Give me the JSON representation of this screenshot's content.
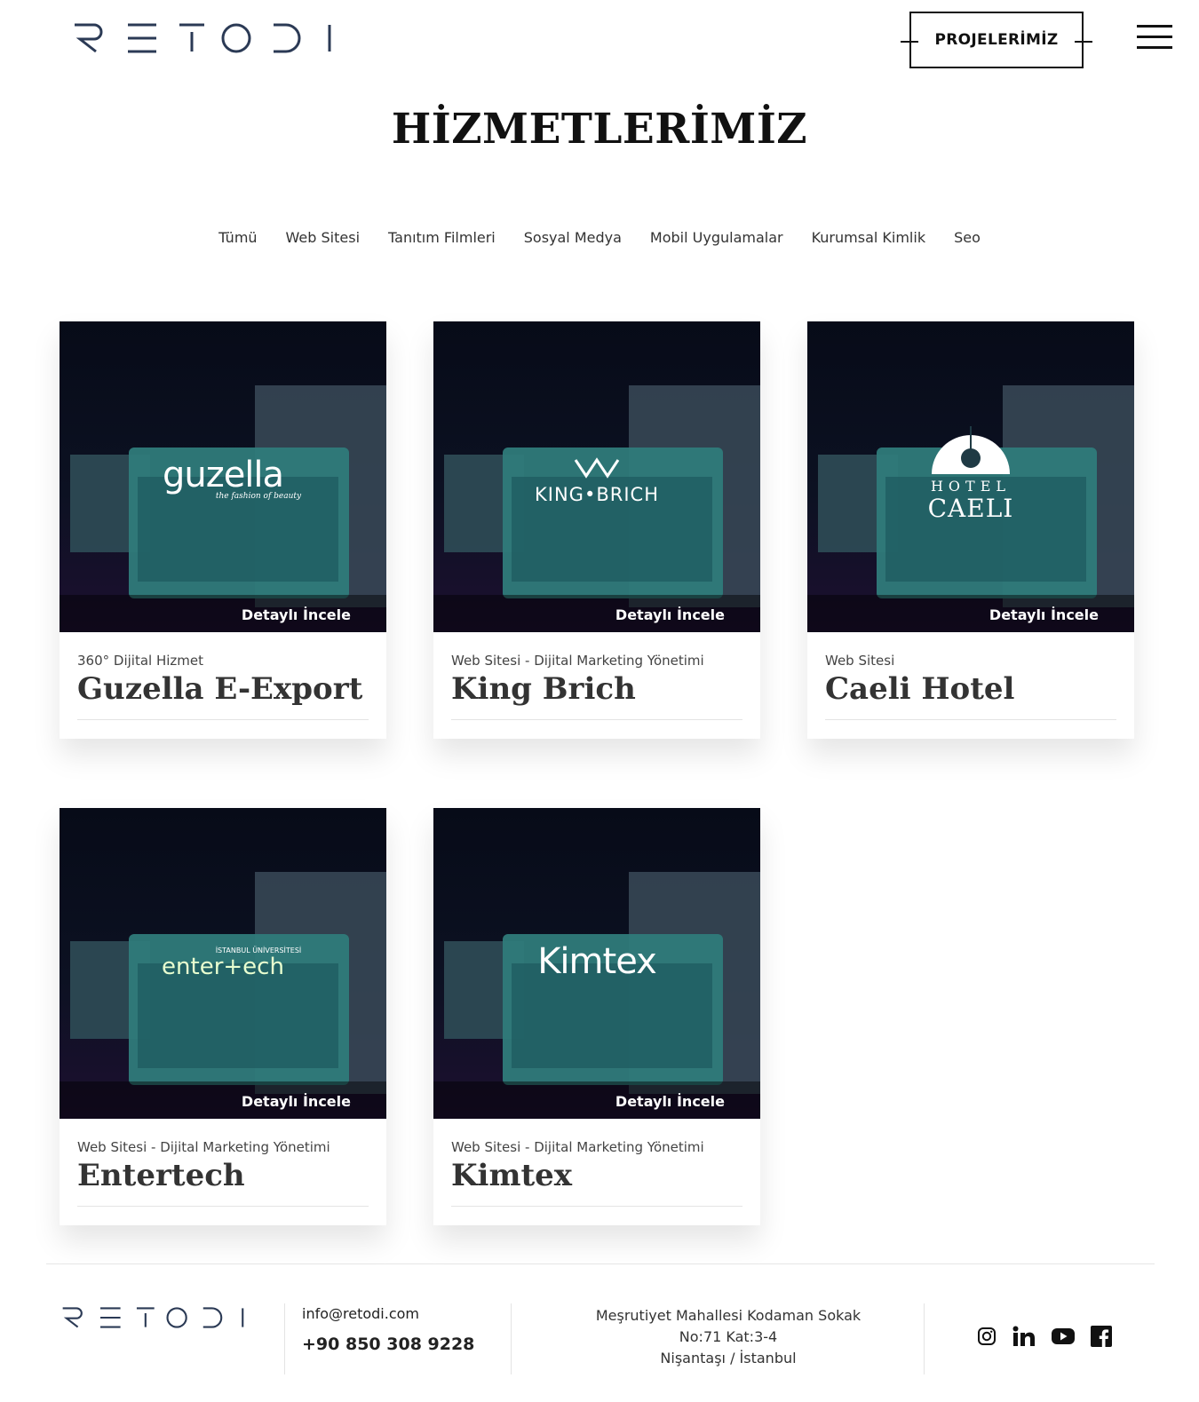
{
  "header": {
    "logo_text": "RETODI",
    "projects_button": "PROJELERİMİZ"
  },
  "page": {
    "title": "HİZMETLERİMİZ"
  },
  "filters": [
    "Tümü",
    "Web Sitesi",
    "Tanıtım Filmleri",
    "Sosyal Medya",
    "Mobil Uygulamalar",
    "Kurumsal Kimlik",
    "Seo"
  ],
  "detail_label": "Detaylı İncele",
  "projects": [
    {
      "category": "360° Dijital Hizmet",
      "title": "Guzella E-Export",
      "thumb_logo": "guzella",
      "thumb_tagline": "the fashion of beauty"
    },
    {
      "category": "Web Sitesi - Dijital Marketing Yönetimi",
      "title": "King Brich",
      "thumb_logo": "KING•BRICH"
    },
    {
      "category": "Web Sitesi",
      "title": "Caeli Hotel",
      "thumb_logo_top": "HOTEL",
      "thumb_logo": "CAELI"
    },
    {
      "category": "Web Sitesi - Dijital Marketing Yönetimi",
      "title": "Entertech",
      "thumb_logo": "enter+ech",
      "thumb_tagline": "İSTANBUL ÜNİVERSİTESİ"
    },
    {
      "category": "Web Sitesi - Dijital Marketing Yönetimi",
      "title": "Kimtex",
      "thumb_logo": "Kimtex"
    }
  ],
  "footer": {
    "email": "info@retodi.com",
    "phone": "+90 850 308 9228",
    "address": [
      "Meşrutiyet Mahallesi Kodaman Sokak",
      "No:71 Kat:3-4",
      "Nişantaşı / İstanbul"
    ],
    "socials": [
      "instagram-icon",
      "linkedin-icon",
      "youtube-icon",
      "facebook-icon"
    ]
  },
  "colors": {
    "logo": "#2b3a55",
    "thumb_dark": "#070b18",
    "thumb_teal": "#2f7b7a"
  }
}
